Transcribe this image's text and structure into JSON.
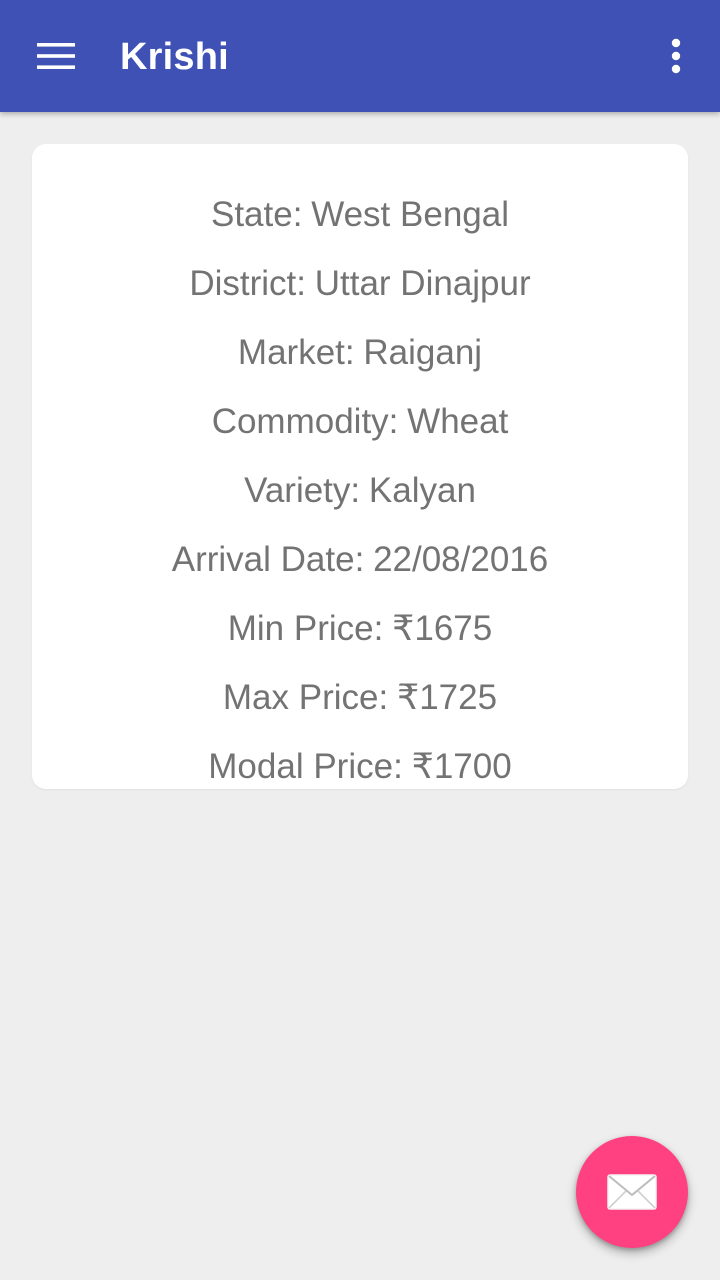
{
  "app_bar": {
    "title": "Krishi",
    "color": "#3f51b5",
    "nav_icon": "hamburger-menu-icon",
    "overflow_icon": "more-vertical-icon"
  },
  "card": {
    "fields": [
      {
        "label": "State:",
        "value": "West Bengal"
      },
      {
        "label": "District:",
        "value": "Uttar Dinajpur"
      },
      {
        "label": "Market:",
        "value": "Raiganj"
      },
      {
        "label": "Commodity:",
        "value": "Wheat"
      },
      {
        "label": "Variety:",
        "value": "Kalyan"
      },
      {
        "label": "Arrival Date:",
        "value": "22/08/2016"
      },
      {
        "label": "Min Price:",
        "value": "₹1675"
      },
      {
        "label": "Max Price:",
        "value": "₹1725"
      },
      {
        "label": "Modal Price:",
        "value": "₹1700"
      }
    ]
  },
  "fab": {
    "icon": "envelope-icon",
    "color": "#ff4081"
  }
}
